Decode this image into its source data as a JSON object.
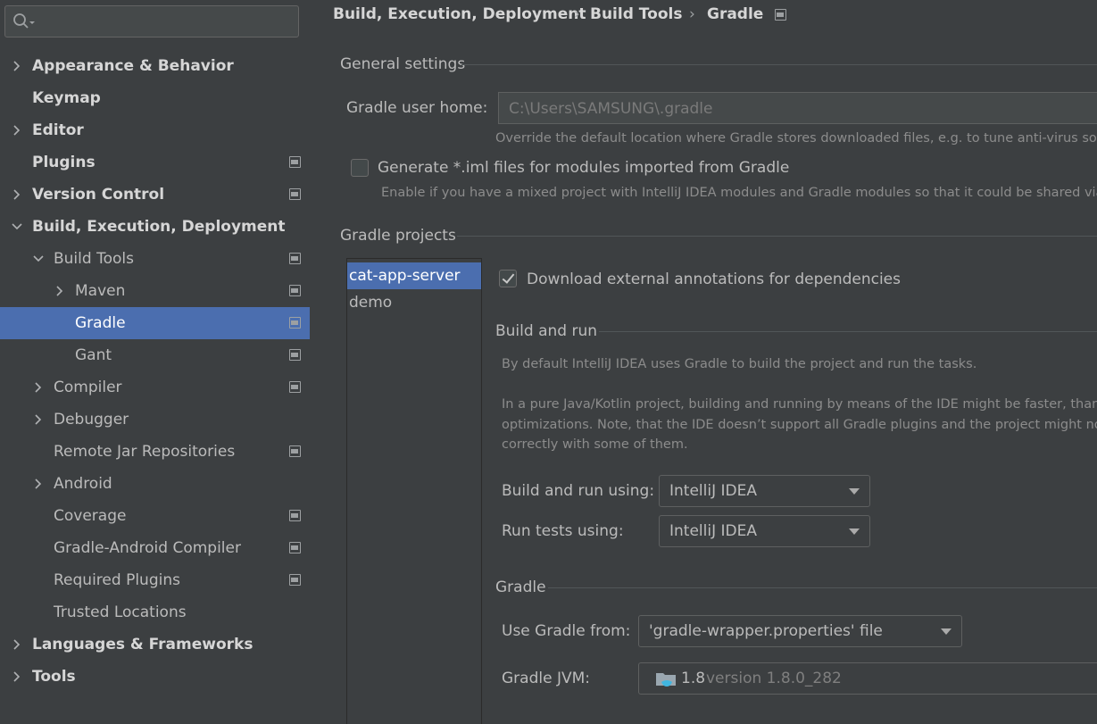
{
  "search": {
    "placeholder": "",
    "value": ""
  },
  "sidebar": {
    "items": [
      {
        "label": "Appearance & Behavior",
        "has_chevron": true,
        "chevron": "right",
        "bold": true,
        "has_project_icon": false
      },
      {
        "label": "Keymap",
        "has_chevron": false,
        "bold": true,
        "has_project_icon": false
      },
      {
        "label": "Editor",
        "has_chevron": true,
        "chevron": "right",
        "bold": true,
        "has_project_icon": false
      },
      {
        "label": "Plugins",
        "has_chevron": false,
        "bold": true,
        "has_project_icon": true
      },
      {
        "label": "Version Control",
        "has_chevron": true,
        "chevron": "right",
        "bold": true,
        "has_project_icon": true
      },
      {
        "label": "Build, Execution, Deployment",
        "has_chevron": true,
        "chevron": "down",
        "bold": true,
        "has_project_icon": false
      },
      {
        "label": "Build Tools",
        "has_chevron": true,
        "chevron": "down",
        "bold": false,
        "has_project_icon": true
      },
      {
        "label": "Maven",
        "has_chevron": true,
        "chevron": "right",
        "bold": false,
        "has_project_icon": true
      },
      {
        "label": "Gradle",
        "has_chevron": false,
        "bold": false,
        "has_project_icon": true,
        "selected": true
      },
      {
        "label": "Gant",
        "has_chevron": false,
        "bold": false,
        "has_project_icon": true
      },
      {
        "label": "Compiler",
        "has_chevron": true,
        "chevron": "right",
        "bold": false,
        "has_project_icon": true
      },
      {
        "label": "Debugger",
        "has_chevron": true,
        "chevron": "right",
        "bold": false,
        "has_project_icon": false
      },
      {
        "label": "Remote Jar Repositories",
        "has_chevron": false,
        "bold": false,
        "has_project_icon": true
      },
      {
        "label": "Android",
        "has_chevron": true,
        "chevron": "right",
        "bold": false,
        "has_project_icon": false
      },
      {
        "label": "Coverage",
        "has_chevron": false,
        "bold": false,
        "has_project_icon": true
      },
      {
        "label": "Gradle-Android Compiler",
        "has_chevron": false,
        "bold": false,
        "has_project_icon": true
      },
      {
        "label": "Required Plugins",
        "has_chevron": false,
        "bold": false,
        "has_project_icon": true
      },
      {
        "label": "Trusted Locations",
        "has_chevron": false,
        "bold": false,
        "has_project_icon": false
      },
      {
        "label": "Languages & Frameworks",
        "has_chevron": true,
        "chevron": "right",
        "bold": true,
        "has_project_icon": false
      },
      {
        "label": "Tools",
        "has_chevron": true,
        "chevron": "right",
        "bold": true,
        "has_project_icon": false
      }
    ]
  },
  "breadcrumb": {
    "parts": [
      "Build, Execution, Deployment",
      "Build Tools",
      "Gradle"
    ],
    "separator": "›"
  },
  "general": {
    "title": "General settings",
    "user_home_label": "Gradle user home:",
    "user_home_value": "C:\\Users\\SAMSUNG\\.gradle",
    "user_home_hint": "Override the default location where Gradle stores downloaded files, e.g. to tune anti-virus software",
    "generate_iml_label": "Generate *.iml files for modules imported from Gradle",
    "generate_iml_checked": false,
    "generate_iml_hint": "Enable if you have a mixed project with IntelliJ IDEA modules and Gradle modules so that it could be shared via VCS"
  },
  "projects": {
    "title": "Gradle projects",
    "list": [
      "cat-app-server",
      "demo"
    ],
    "selected": "cat-app-server",
    "download_annotations_label": "Download external annotations for dependencies",
    "download_annotations_checked": true
  },
  "build_and_run": {
    "title": "Build and run",
    "desc1": "By default IntelliJ IDEA uses Gradle to build the project and run the tasks.",
    "desc2_line1": "In a pure Java/Kotlin project, building and running by means of the IDE might be faster, thanks to",
    "desc2_line2": "optimizations. Note, that the IDE doesn’t support all Gradle plugins and the project might not be b",
    "desc2_line3": "correctly with some of them.",
    "build_run_using_label": "Build and run using:",
    "build_run_using_value": "IntelliJ IDEA",
    "run_tests_label": "Run tests using:",
    "run_tests_value": "IntelliJ IDEA"
  },
  "gradle": {
    "title": "Gradle",
    "use_from_label": "Use Gradle from:",
    "use_from_value": "'gradle-wrapper.properties' file",
    "jvm_label": "Gradle JVM:",
    "jvm_value": "1.8",
    "jvm_version": "version 1.8.0_282"
  },
  "colors": {
    "background": "#3c3f41",
    "selection": "#4b6eaf",
    "text": "#bbbbbb",
    "hint": "#8c8c8c"
  }
}
